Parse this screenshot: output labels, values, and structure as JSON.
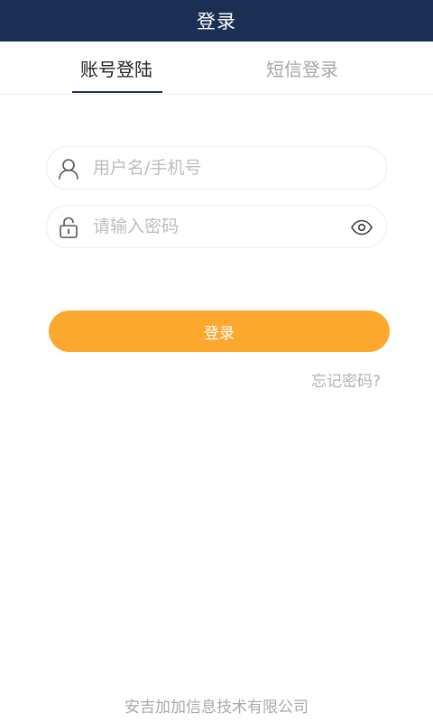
{
  "header": {
    "title": "登录"
  },
  "tabs": [
    {
      "label": "账号登陆",
      "active": true
    },
    {
      "label": "短信登录",
      "active": false
    }
  ],
  "form": {
    "username": {
      "placeholder": "用户名/手机号",
      "value": "",
      "icon": "user-icon"
    },
    "password": {
      "placeholder": "请输入密码",
      "value": "",
      "icon": "lock-icon",
      "toggle_icon": "eye-icon"
    },
    "login_label": "登录",
    "forgot_label": "忘记密码?"
  },
  "footer": {
    "company": "安吉加加信息技术有限公司"
  },
  "colors": {
    "header_bg": "#1b2f54",
    "button_bg": "#fca82e",
    "active_tab": "#222222",
    "inactive_tab": "#a7a7a7",
    "placeholder": "#bdbdbd"
  }
}
